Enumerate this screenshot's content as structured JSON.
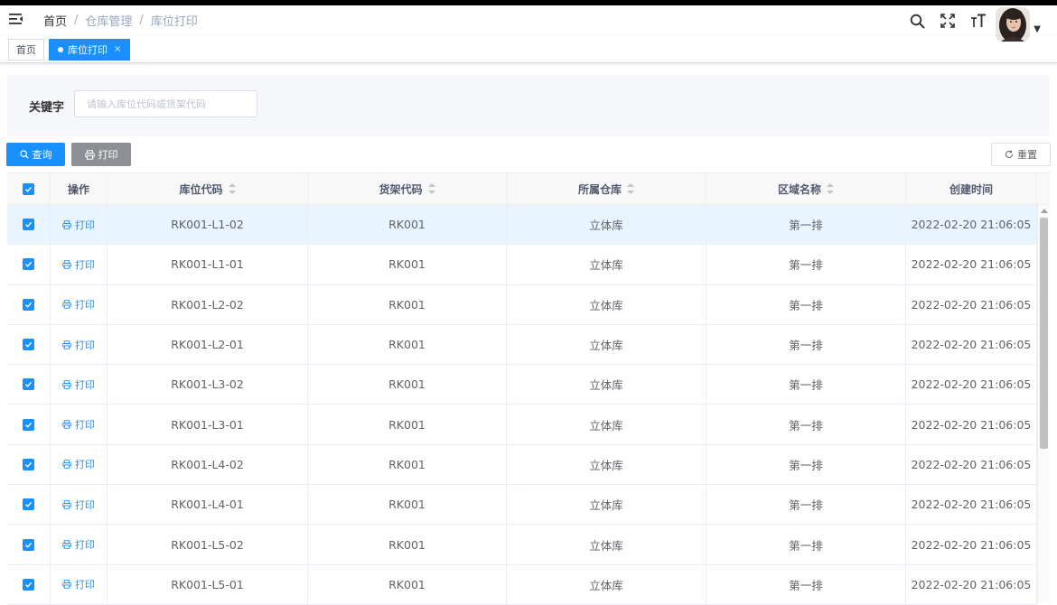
{
  "breadcrumb": {
    "home": "首页",
    "level2": "仓库管理",
    "current": "库位打印",
    "separator": "/"
  },
  "tags": {
    "home": "首页",
    "active": "库位打印",
    "close": "×"
  },
  "search": {
    "keyword_label": "关键字",
    "placeholder": "请输入库位代码或货架代码",
    "value": ""
  },
  "toolbar": {
    "query_label": "查询",
    "print_label": "打印",
    "reset_label": "重置"
  },
  "table": {
    "columns": [
      "操作",
      "库位代码",
      "货架代码",
      "所属仓库",
      "区域名称",
      "创建时间"
    ],
    "print_action": "打印",
    "rows": [
      {
        "code": "RK001-L1-02",
        "shelf": "RK001",
        "warehouse": "立体库",
        "area": "第一排",
        "created": "2022-02-20 21:06:05",
        "checked": true
      },
      {
        "code": "RK001-L1-01",
        "shelf": "RK001",
        "warehouse": "立体库",
        "area": "第一排",
        "created": "2022-02-20 21:06:05",
        "checked": true
      },
      {
        "code": "RK001-L2-02",
        "shelf": "RK001",
        "warehouse": "立体库",
        "area": "第一排",
        "created": "2022-02-20 21:06:05",
        "checked": true
      },
      {
        "code": "RK001-L2-01",
        "shelf": "RK001",
        "warehouse": "立体库",
        "area": "第一排",
        "created": "2022-02-20 21:06:05",
        "checked": true
      },
      {
        "code": "RK001-L3-02",
        "shelf": "RK001",
        "warehouse": "立体库",
        "area": "第一排",
        "created": "2022-02-20 21:06:05",
        "checked": true
      },
      {
        "code": "RK001-L3-01",
        "shelf": "RK001",
        "warehouse": "立体库",
        "area": "第一排",
        "created": "2022-02-20 21:06:05",
        "checked": true
      },
      {
        "code": "RK001-L4-02",
        "shelf": "RK001",
        "warehouse": "立体库",
        "area": "第一排",
        "created": "2022-02-20 21:06:05",
        "checked": true
      },
      {
        "code": "RK001-L4-01",
        "shelf": "RK001",
        "warehouse": "立体库",
        "area": "第一排",
        "created": "2022-02-20 21:06:05",
        "checked": true
      },
      {
        "code": "RK001-L5-02",
        "shelf": "RK001",
        "warehouse": "立体库",
        "area": "第一排",
        "created": "2022-02-20 21:06:05",
        "checked": true
      },
      {
        "code": "RK001-L5-01",
        "shelf": "RK001",
        "warehouse": "立体库",
        "area": "第一排",
        "created": "2022-02-20 21:06:05",
        "checked": true
      }
    ]
  },
  "icons": {
    "menu": "hamburger-icon",
    "search": "search-icon",
    "fullscreen": "fullscreen-icon",
    "font_size": "font-size-icon",
    "avatar": "user-avatar",
    "query": "search-icon",
    "print": "printer-icon",
    "reset": "refresh-icon",
    "checkbox": "checkbox-checked-icon",
    "sort": "sort-icon"
  },
  "colors": {
    "primary": "#1890ff",
    "print_button": "#8c8f94",
    "highlight_row": "#e8f4ff",
    "header_bg": "#f8f8f9"
  }
}
